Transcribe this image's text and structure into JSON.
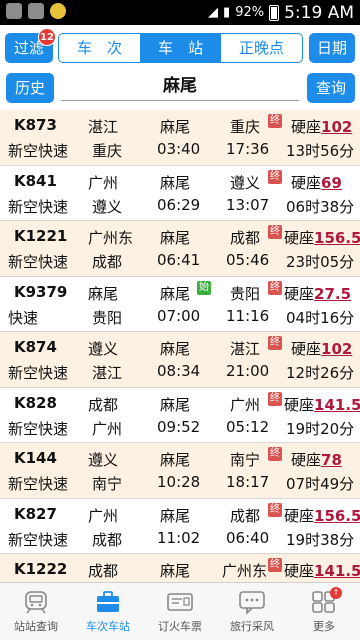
{
  "status_bar": {
    "time": "5:19 AM",
    "battery": "92%"
  },
  "header": {
    "filter_label": "过滤",
    "filter_badge": "12",
    "tabs": [
      {
        "label": "车　次",
        "active": false
      },
      {
        "label": "车　站",
        "active": true
      },
      {
        "label": "正晚点",
        "active": false
      }
    ],
    "date_label": "日期",
    "history_label": "历史",
    "station_value": "麻尾",
    "query_label": "查询"
  },
  "trains": [
    {
      "no": "K873",
      "type": "新空快速",
      "from": "湛江",
      "to": "重庆",
      "station": "麻尾",
      "arrive": "03:40",
      "dest": "重庆",
      "dest_tag": "终",
      "depart": "17:36",
      "seat": "硬座",
      "price": "102",
      "duration": "13时56分"
    },
    {
      "no": "K841",
      "type": "新空快速",
      "from": "广州",
      "to": "遵义",
      "station": "麻尾",
      "arrive": "06:29",
      "dest": "遵义",
      "dest_tag": "终",
      "depart": "13:07",
      "seat": "硬座",
      "price": "69",
      "duration": "06时38分"
    },
    {
      "no": "K1221",
      "type": "新空快速",
      "from": "广州东",
      "to": "成都",
      "station": "麻尾",
      "arrive": "06:41",
      "dest": "成都",
      "dest_tag": "终",
      "depart": "05:46",
      "seat": "硬座",
      "price": "156.5",
      "duration": "23时05分"
    },
    {
      "no": "K9379",
      "type": "快速",
      "from": "麻尾",
      "to": "贵阳",
      "station": "麻尾",
      "station_tag": "始",
      "arrive": "07:00",
      "dest": "贵阳",
      "dest_tag": "终",
      "depart": "11:16",
      "seat": "硬座",
      "price": "27.5",
      "duration": "04时16分"
    },
    {
      "no": "K874",
      "type": "新空快速",
      "from": "遵义",
      "to": "湛江",
      "station": "麻尾",
      "arrive": "08:34",
      "dest": "湛江",
      "dest_tag": "终",
      "depart": "21:00",
      "seat": "硬座",
      "price": "102",
      "duration": "12时26分"
    },
    {
      "no": "K828",
      "type": "新空快速",
      "from": "成都",
      "to": "广州",
      "station": "麻尾",
      "arrive": "09:52",
      "dest": "广州",
      "dest_tag": "终",
      "depart": "05:12",
      "seat": "硬座",
      "price": "141.5",
      "duration": "19时20分"
    },
    {
      "no": "K144",
      "type": "新空快速",
      "from": "遵义",
      "to": "南宁",
      "station": "麻尾",
      "arrive": "10:28",
      "dest": "南宁",
      "dest_tag": "终",
      "depart": "18:17",
      "seat": "硬座",
      "price": "78",
      "duration": "07时49分"
    },
    {
      "no": "K827",
      "type": "新空快速",
      "from": "广州",
      "to": "成都",
      "station": "麻尾",
      "arrive": "11:02",
      "dest": "成都",
      "dest_tag": "终",
      "depart": "06:40",
      "seat": "硬座",
      "price": "156.5",
      "duration": "19时38分"
    },
    {
      "no": "K1222",
      "type": "",
      "from": "成都",
      "to": "",
      "station": "麻尾",
      "arrive": "",
      "dest": "广州东",
      "dest_tag": "终",
      "depart": "",
      "seat": "硬座",
      "price": "141.5",
      "duration": ""
    }
  ],
  "bottom_nav": [
    {
      "label": "站站查询",
      "icon": "train-icon",
      "active": false
    },
    {
      "label": "车次车站",
      "icon": "briefcase-icon",
      "active": true
    },
    {
      "label": "订火车票",
      "icon": "ticket-icon",
      "active": false
    },
    {
      "label": "旅行采风",
      "icon": "chat-icon",
      "active": false
    },
    {
      "label": "更多",
      "icon": "grid-icon",
      "active": false,
      "badge": "↑"
    }
  ]
}
